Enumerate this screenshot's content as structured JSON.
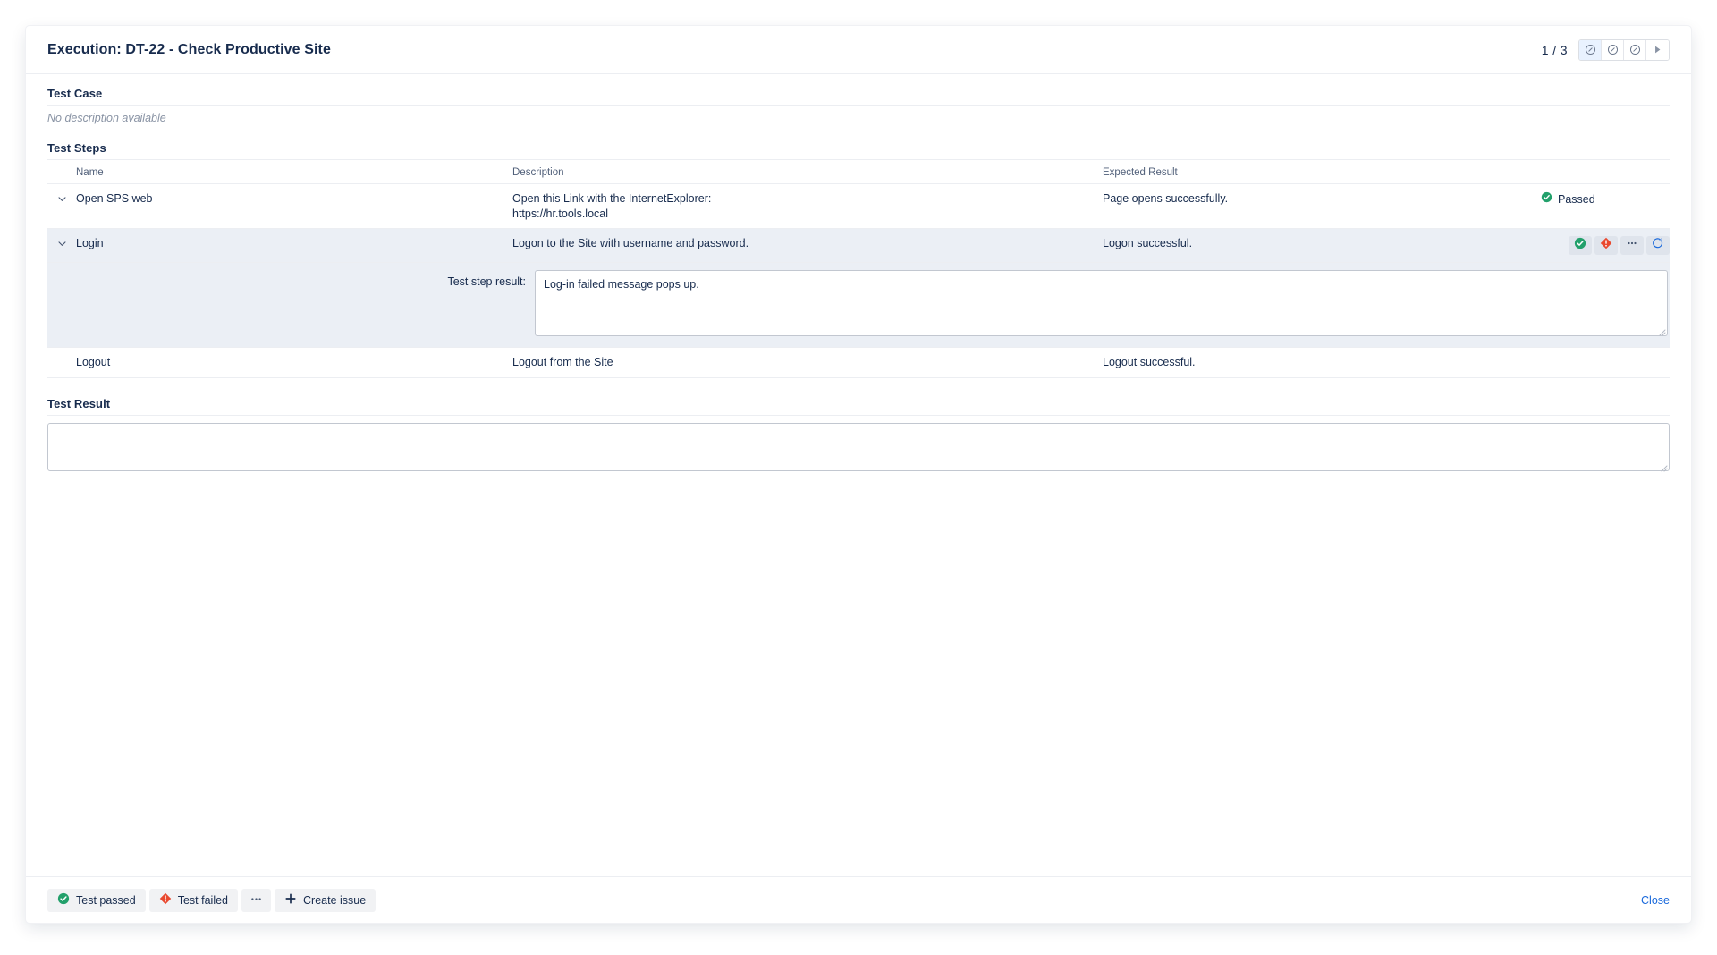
{
  "dialog": {
    "title": "Execution: DT-22 - Check Productive Site",
    "page_count": "1 / 3",
    "nav_buttons": [
      {
        "name": "status-circle-1",
        "icon": "circle-slash-icon",
        "active": true
      },
      {
        "name": "status-circle-2",
        "icon": "circle-slash-icon",
        "active": false
      },
      {
        "name": "status-circle-3",
        "icon": "circle-slash-icon",
        "active": false
      },
      {
        "name": "next-execution",
        "icon": "play-next-icon",
        "active": false
      }
    ]
  },
  "test_case": {
    "heading": "Test Case",
    "description": "No description available"
  },
  "test_steps": {
    "heading": "Test Steps",
    "columns": {
      "name": "Name",
      "description": "Description",
      "expected_result": "Expected Result",
      "actions": ""
    },
    "rows": [
      {
        "name": "Open SPS web",
        "description_line1": "Open this Link with the InternetExplorer:",
        "description_line2": "https://hr.tools.local",
        "expected_result": "Page opens successfully.",
        "status_label": "Passed",
        "status_color": "#22a06b",
        "has_chevron": true,
        "selected": false
      },
      {
        "name": "Login",
        "description_line1": "Logon to the Site with username and password.",
        "description_line2": "",
        "expected_result": "Logon successful.",
        "status_label": "",
        "status_color": "",
        "has_chevron": true,
        "selected": true
      },
      {
        "name": "Logout",
        "description_line1": "Logout from the Site",
        "description_line2": "",
        "expected_result": "Logout successful.",
        "status_label": "",
        "status_color": "",
        "has_chevron": false,
        "selected": false
      }
    ],
    "row_actions": [
      {
        "name": "mark-step-passed-button",
        "icon": "check-circle-icon"
      },
      {
        "name": "mark-step-failed-button",
        "icon": "failed-diamond-icon"
      },
      {
        "name": "step-more-options-button",
        "icon": "ellipsis-icon"
      },
      {
        "name": "reset-step-status-button",
        "icon": "refresh-circle-icon"
      }
    ],
    "step_result": {
      "label": "Test step result:",
      "value": "Log-in failed message pops up.",
      "placeholder": ""
    }
  },
  "test_result": {
    "heading": "Test Result",
    "value": "",
    "placeholder": ""
  },
  "footer": {
    "test_passed_label": "Test passed",
    "test_failed_label": "Test failed",
    "more_label": "•••",
    "create_issue_label": "Create issue",
    "close_label": "Close"
  },
  "colors": {
    "pass_green": "#22a06b",
    "fail_red": "#e9492f",
    "link_blue": "#1868db",
    "selected_row": "#ebeff5",
    "text_primary": "#172b4d",
    "text_muted": "#505f79"
  }
}
